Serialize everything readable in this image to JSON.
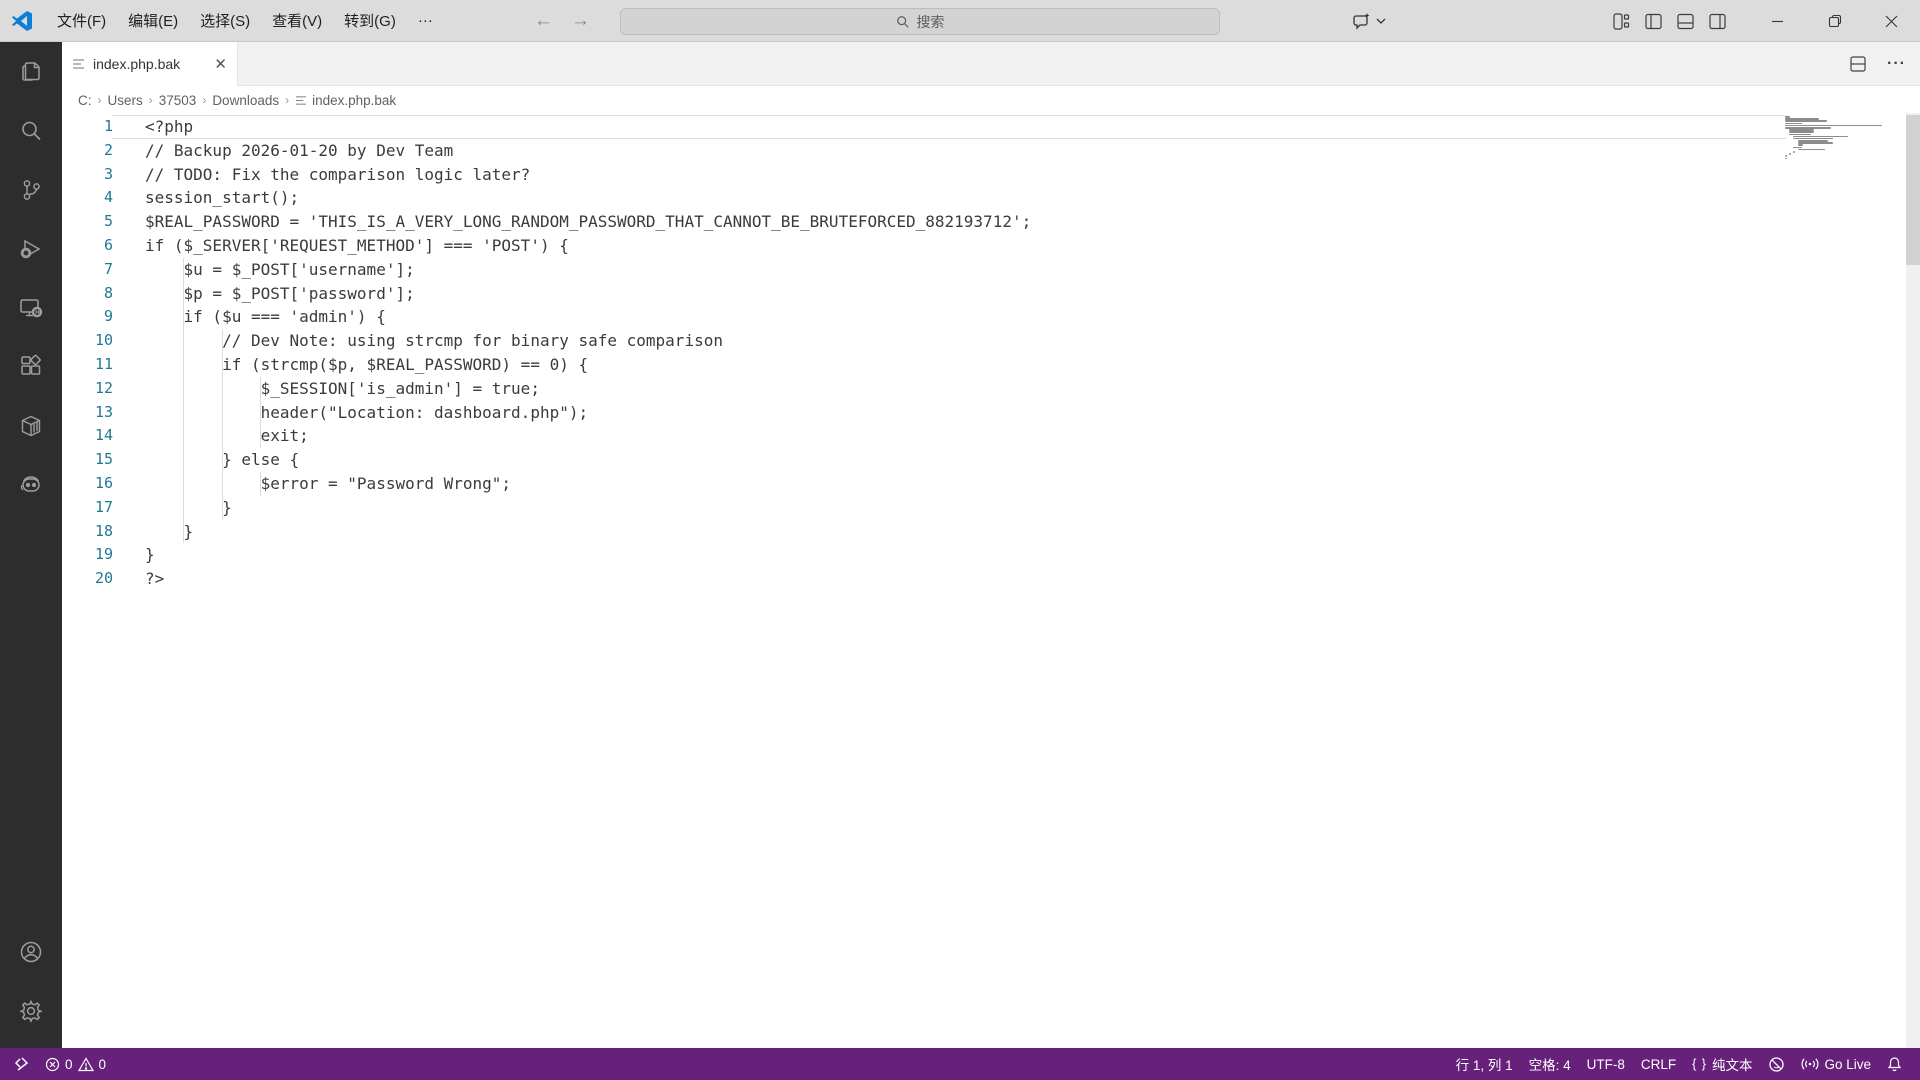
{
  "title_bar": {
    "menus": [
      "文件(F)",
      "编辑(E)",
      "选择(S)",
      "查看(V)",
      "转到(G)",
      "···"
    ],
    "search_placeholder": "搜索",
    "back_arrow": "←",
    "forward_arrow": "→"
  },
  "tab_bar": {
    "active_tab": "index.php.bak",
    "close_glyph": "✕",
    "more_actions": "···"
  },
  "breadcrumb": {
    "items": [
      "C:",
      "Users",
      "37503",
      "Downloads"
    ],
    "file": "index.php.bak",
    "separator": "›"
  },
  "editor": {
    "code_lines": [
      "<?php",
      "// Backup 2026-01-20 by Dev Team",
      "// TODO: Fix the comparison logic later?",
      "session_start();",
      "$REAL_PASSWORD = 'THIS_IS_A_VERY_LONG_RANDOM_PASSWORD_THAT_CANNOT_BE_BRUTEFORCED_882193712';",
      "if ($_SERVER['REQUEST_METHOD'] === 'POST') {",
      "    $u = $_POST['username'];",
      "    $p = $_POST['password'];",
      "    if ($u === 'admin') {",
      "        // Dev Note: using strcmp for binary safe comparison",
      "        if (strcmp($p, $REAL_PASSWORD) == 0) {",
      "            $_SESSION['is_admin'] = true;",
      "            header(\"Location: dashboard.php\");",
      "            exit;",
      "        } else {",
      "            $error = \"Password Wrong\";",
      "        }",
      "    }",
      "}",
      "?>"
    ],
    "cursor_line": 1
  },
  "activity_bar": {
    "icons": [
      "explorer-icon",
      "search-icon",
      "source-control-icon",
      "run-debug-icon",
      "remote-explorer-icon",
      "extensions-icon",
      "container-icon",
      "robot-icon"
    ],
    "bottom_icons": [
      "account-icon",
      "settings-gear-icon"
    ]
  },
  "status_bar": {
    "error_count": "0",
    "warning_count": "0",
    "line_col": "行 1, 列 1",
    "indent": "空格: 4",
    "encoding": "UTF-8",
    "eol": "CRLF",
    "braces_glyph": "{ }",
    "language": "纯文本",
    "live_server": "Go Live"
  },
  "colors": {
    "status_bar_bg": "#68217A",
    "line_number": "#237893",
    "code_text": "#3b3b3b",
    "titlebar_bg": "#dcdcdc",
    "activitybar_bg": "#2d2d2d"
  }
}
